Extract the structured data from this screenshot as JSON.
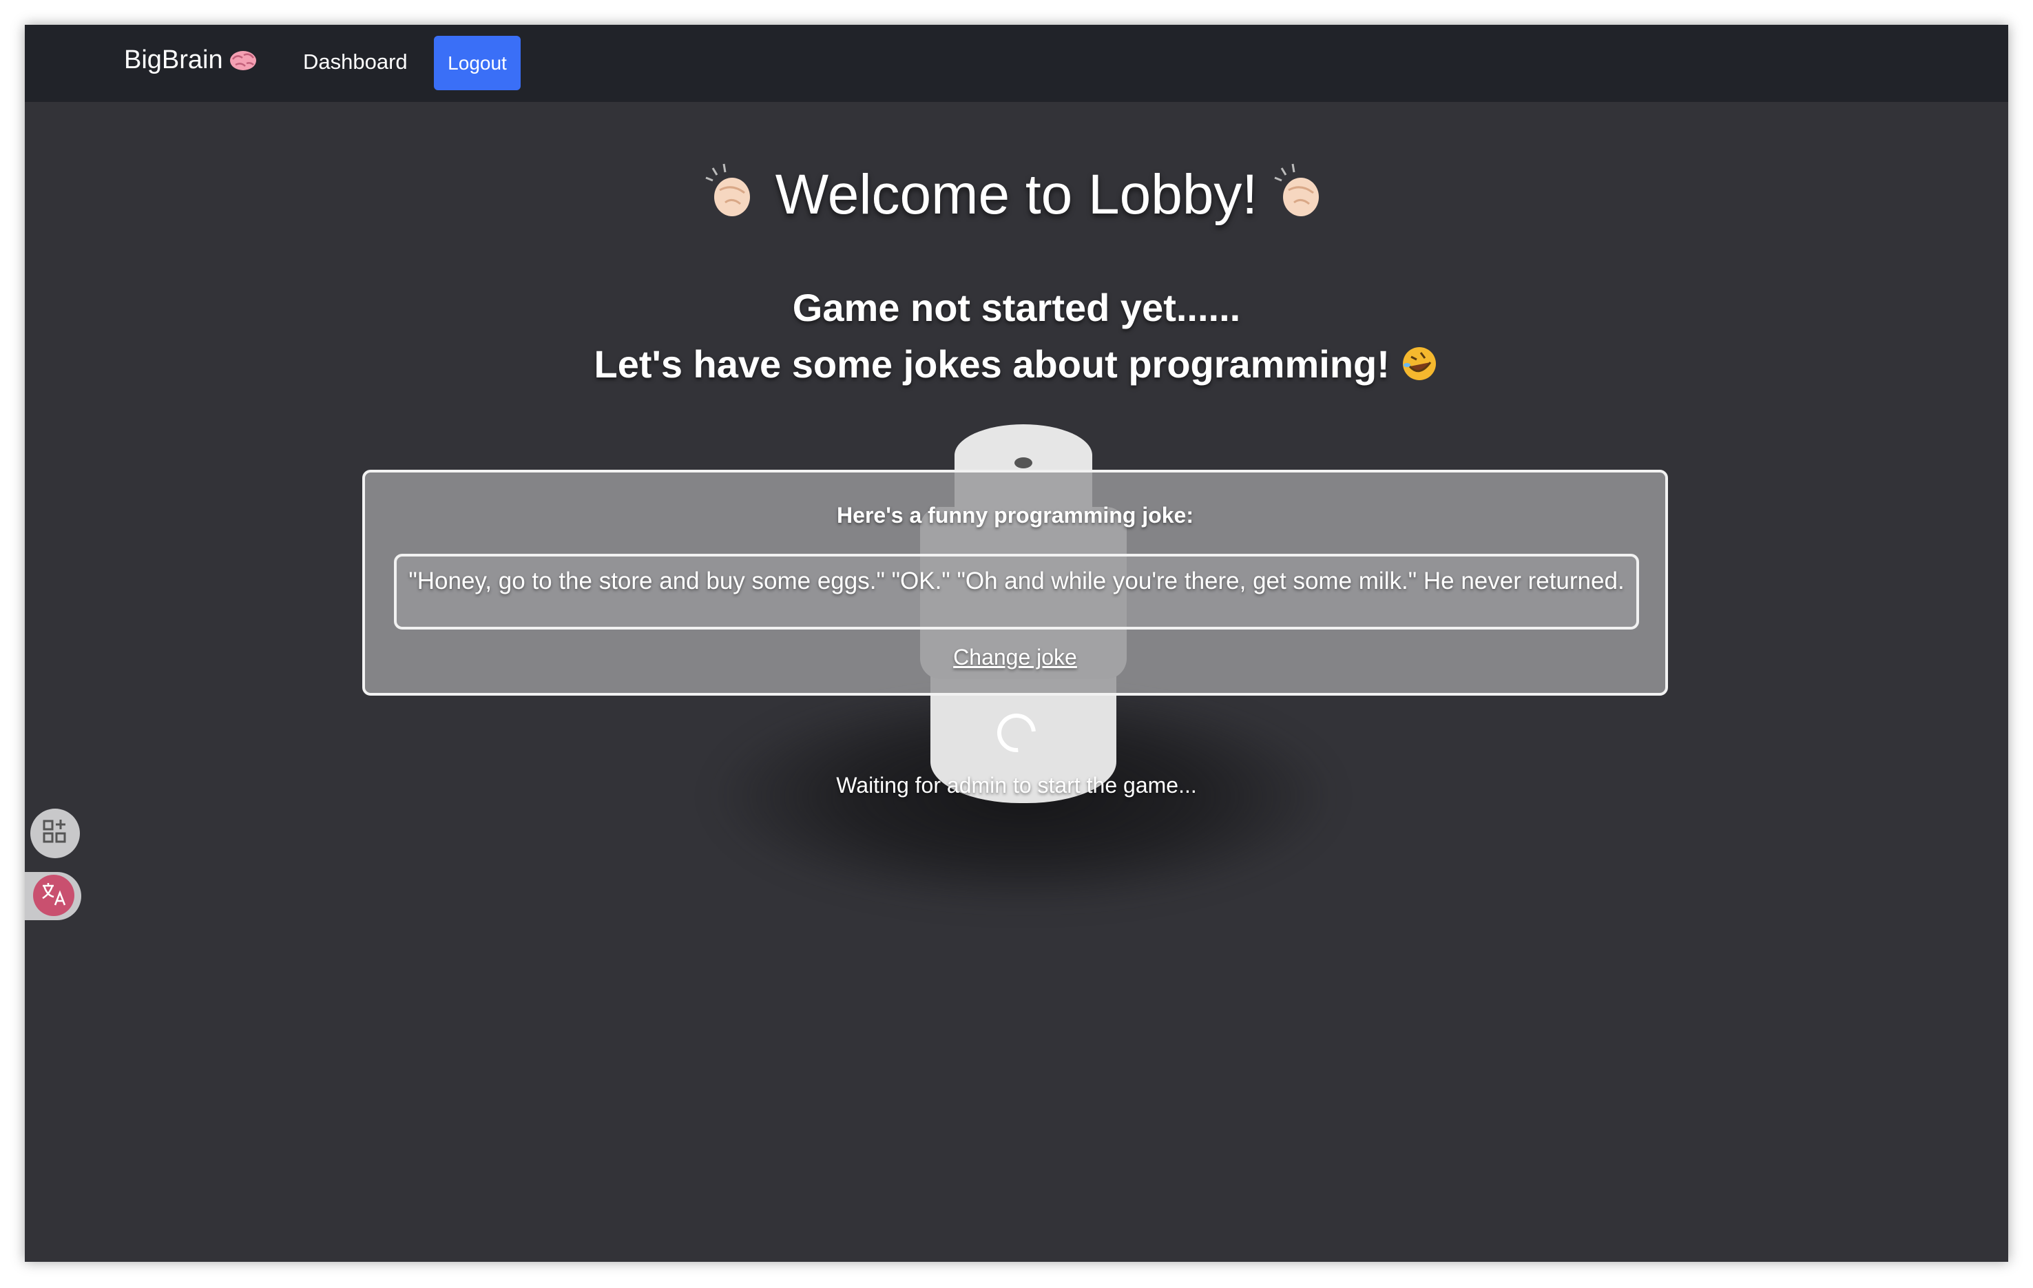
{
  "navbar": {
    "brand": "BigBrain",
    "brand_icon": "brain-icon",
    "dashboard_label": "Dashboard",
    "logout_label": "Logout",
    "logout_color": "#3a6ff7"
  },
  "lobby": {
    "title": "Welcome to Lobby!",
    "title_icon": "clapping-hands-icon",
    "subtitle_line1": "Game not started yet......",
    "subtitle_line2": "Let's have some jokes about programming!",
    "subtitle_icon": "rofl-face-icon"
  },
  "joke": {
    "heading": "Here's a funny programming joke:",
    "text": "\"Honey, go to the store and buy some eggs.\" \"OK.\" \"Oh and while you're there, get some milk.\" He never returned.",
    "change_label": "Change joke"
  },
  "status": {
    "waiting_text": "Waiting for admin to start the game..."
  },
  "side_widgets": {
    "apps_icon": "apps-add-icon",
    "translate_icon": "translate-icon"
  }
}
